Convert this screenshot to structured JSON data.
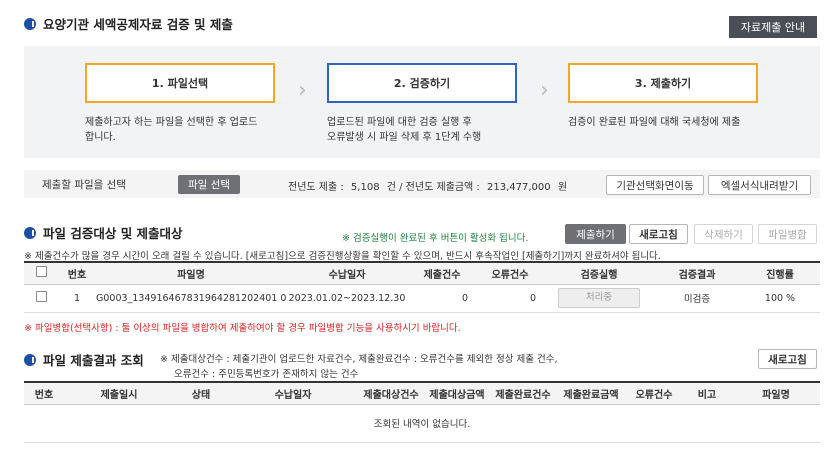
{
  "header": {
    "title": "요양기관 세액공제자료 검증 및 제출",
    "guide_button": "자료제출 안내"
  },
  "steps": [
    {
      "label": "1. 파일선택",
      "desc_line1": "제출하고자 하는 파일을 선택한 후 업로드",
      "desc_line2": "합니다.",
      "color": "#f5a623"
    },
    {
      "label": "2. 검증하기",
      "desc_line1": "업로드된 파일에 대한 검증 실행 후",
      "desc_line2": "오류발생 시 파일 삭제 후 1단계 수행",
      "color": "#2f63c4"
    },
    {
      "label": "3. 제출하기",
      "desc_line1": "검증이 완료된 파일에 대해 국세청에 제출",
      "desc_line2": "",
      "color": "#f5a623"
    }
  ],
  "file_select": {
    "label": "제출할 파일을 선택",
    "button": "파일 선택",
    "summary_prefix": "전년도 제출 :",
    "count": "5,108",
    "count_unit": "건 / 전년도 제출금액 :",
    "amount": "213,477,000",
    "amount_unit": "원",
    "btn_move": "기관선택화면이동",
    "btn_download": "엑셀서식내려받기"
  },
  "verify": {
    "title": "파일 검증대상 및 제출대상",
    "notice": "※ 검증실행이 완료된 후 버튼이 활성화 됩니다.",
    "btn_submit": "제출하기",
    "btn_refresh": "새로고침",
    "btn_delete": "삭제하기",
    "btn_merge": "파일병합",
    "info": "※ 제출건수가 많을 경우 시간이 오래 걸릴 수 있습니다. [새로고침]으로 검증진행상황을 확인할 수 있으며, 반드시 후속작업인 [제출하기]까지 완료하셔야 됩니다.",
    "columns": [
      "번호",
      "파일명",
      "수납일자",
      "제출건수",
      "오류건수",
      "검증실행",
      "검증결과",
      "진행률"
    ],
    "rows": [
      {
        "no": "1",
        "filename": "G0003_134916467831964281202401 03.D001",
        "period": "2023.01.02~2023.12.30",
        "submit_count": "0",
        "error_count": "0",
        "action": "처리중",
        "result": "미검증",
        "progress": "100 %"
      }
    ],
    "merge_note": "※ 파일병합(선택사항) : 둘 이상의 파일을 병합하여 제출하여야 할 경우 파일병합 기능을 사용하시기 바랍니다."
  },
  "result": {
    "title": "파일 제출결과 조회",
    "note_line1": "※ 제출대상건수 : 제출기관이 업로드한 자료건수, 제출완료건수 : 오류건수를 제외한 정상 제출 건수,",
    "note_line2": "오류건수 : 주민등록번호가 존재하지 않는 건수",
    "btn_refresh": "새로고침",
    "columns": [
      "번호",
      "제출일시",
      "상태",
      "수납일자",
      "제출대상건수",
      "제출대상금액",
      "제출완료건수",
      "제출완료금액",
      "오류건수",
      "비고",
      "파일명"
    ],
    "empty": "조회된 내역이 없습니다."
  }
}
